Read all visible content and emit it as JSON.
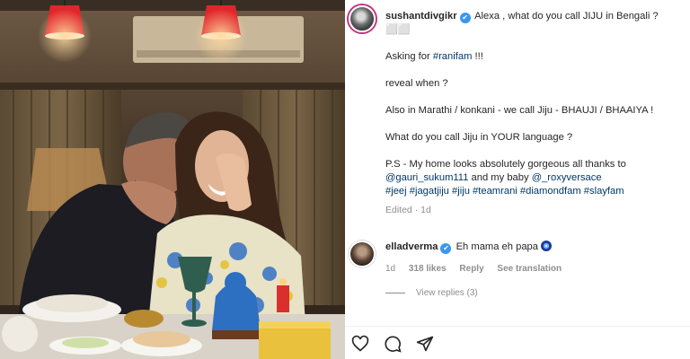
{
  "post": {
    "username": "sushantdivgikr",
    "verified_mark": "✔",
    "caption_first": "Alexa , what do you call JIJU in Bengali ?",
    "caption_emoji": "⬜⬜",
    "asking_prefix": "Asking for",
    "asking_tag": "#ranifam",
    "asking_suffix": "!!!",
    "reveal": "reveal when ?",
    "marathi": "Also in Marathi / konkani - we call Jiju - BHAUJI / BHAAIYA !",
    "language": "What do you call Jiju in YOUR language ?",
    "ps_text": "P.S - My home looks absolutely gorgeous all thanks to",
    "mention_1": "@gauri_sukum111",
    "ps_mid": "and my baby",
    "mention_2": "@_roxyversace",
    "hashtags": "#jeej #jagatjiju #jiju #teamrani #diamondfam #slayfam",
    "edited": "Edited · 1d"
  },
  "comment": {
    "username": "elladverma",
    "verified_mark": "✔",
    "text": "Eh mama eh papa",
    "emoji_icon": "nazar-evil-eye-icon",
    "time": "1d",
    "likes": "318 likes",
    "reply": "Reply",
    "translation": "See translation",
    "view_replies": "View replies (3)"
  },
  "actions": {
    "like_icon": "heart-icon",
    "comment_icon": "comment-icon",
    "share_icon": "share-icon"
  },
  "colors": {
    "link": "#00376b",
    "verified": "#3897f0",
    "muted": "#8e8e8e",
    "lamp_red": "#e0262b"
  }
}
